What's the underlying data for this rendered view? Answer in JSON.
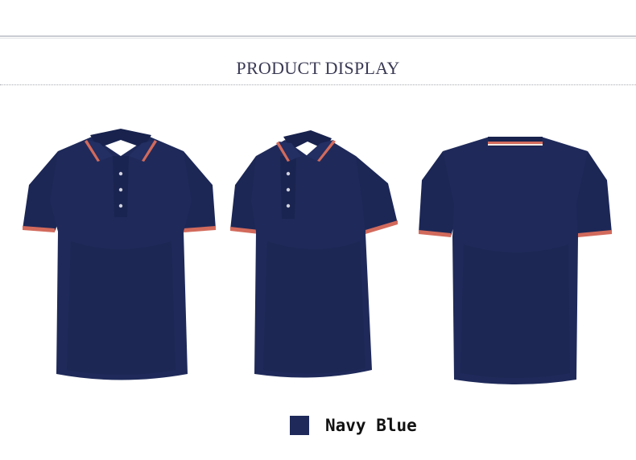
{
  "header": {
    "title": "PRODUCT DISPLAY"
  },
  "product": {
    "color_name": "Navy Blue",
    "colors": {
      "body": "#1f2a5a",
      "body_dark": "#18224d",
      "body_light": "#2a3670",
      "trim_red": "#d26a5c",
      "trim_white": "#f1ece8"
    },
    "views": [
      "front",
      "angled",
      "back"
    ]
  }
}
